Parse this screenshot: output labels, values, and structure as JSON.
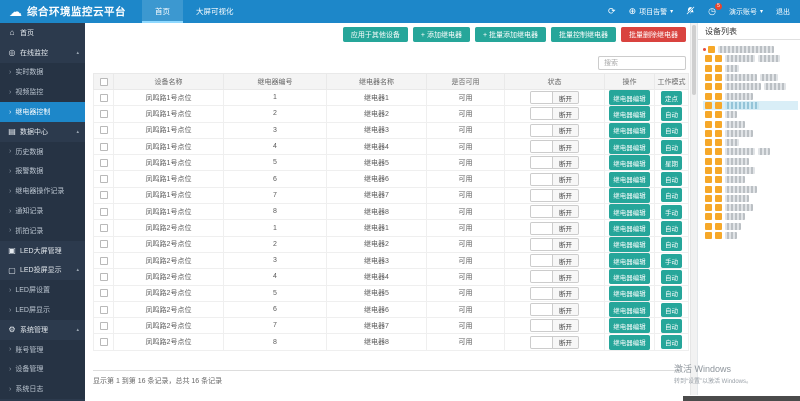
{
  "theme": {
    "navbar": "#1d87c9",
    "sidebar": "#2c3a4d",
    "active_blue": "#1d87c9",
    "teal": "#26a69a",
    "red": "#d9433f"
  },
  "navbar": {
    "title": "综合环境监控云平台",
    "tabs": [
      {
        "id": "home",
        "label": "首页",
        "active": true
      },
      {
        "id": "big-screen",
        "label": "大屏可视化",
        "active": false
      }
    ],
    "right": {
      "refresh": "⟳",
      "alarm_dropdown": "项目告警",
      "badge_count": "5",
      "account": "演示账号",
      "logout": "退出"
    }
  },
  "sidebar": {
    "items": [
      {
        "id": "home",
        "label": "首页",
        "type": "parent",
        "icon": "home"
      },
      {
        "id": "online-monitor",
        "label": "在线监控",
        "type": "parent",
        "icon": "monitor",
        "arrow": true
      },
      {
        "id": "realtime-data",
        "label": "实时数据",
        "type": "sub"
      },
      {
        "id": "video-monitor",
        "label": "视频监控",
        "type": "sub"
      },
      {
        "id": "relay-control",
        "label": "继电器控制",
        "type": "sub",
        "active": true
      },
      {
        "id": "data-center",
        "label": "数据中心",
        "type": "parent",
        "icon": "data",
        "arrow": true
      },
      {
        "id": "history-data",
        "label": "历史数据",
        "type": "sub"
      },
      {
        "id": "alarm-data",
        "label": "报警数据",
        "type": "sub"
      },
      {
        "id": "relay-op-log",
        "label": "继电器操作记录",
        "type": "sub"
      },
      {
        "id": "notify-log",
        "label": "通知记录",
        "type": "sub"
      },
      {
        "id": "snapshot-log",
        "label": "抓拍记录",
        "type": "sub"
      },
      {
        "id": "led-screen-mgmt",
        "label": "LED大屏管理",
        "type": "parent",
        "icon": "led"
      },
      {
        "id": "led-cast-display",
        "label": "LED投屏显示",
        "type": "parent",
        "icon": "screen",
        "arrow": true
      },
      {
        "id": "led-settings",
        "label": "LED屏设置",
        "type": "sub"
      },
      {
        "id": "led-display",
        "label": "LED屏显示",
        "type": "sub"
      },
      {
        "id": "system-mgmt",
        "label": "系统管理",
        "type": "parent",
        "icon": "gear",
        "arrow": true
      },
      {
        "id": "account-mgmt",
        "label": "账号管理",
        "type": "sub"
      },
      {
        "id": "device-mgmt",
        "label": "设备管理",
        "type": "sub"
      },
      {
        "id": "system-log",
        "label": "系统日志",
        "type": "sub"
      }
    ]
  },
  "toolbar": {
    "buttons": [
      {
        "id": "apply-to-other-devices",
        "label": "应用于其他设备",
        "style": "teal"
      },
      {
        "id": "add-relay",
        "label": "+ 添加继电器",
        "style": "teal"
      },
      {
        "id": "batch-add-relay",
        "label": "+ 批量添加继电器",
        "style": "teal"
      },
      {
        "id": "batch-control-relay",
        "label": "批量控制继电器",
        "style": "teal"
      },
      {
        "id": "batch-delete-relay",
        "label": "批量删除继电器",
        "style": "red"
      }
    ]
  },
  "search": {
    "placeholder": "搜索"
  },
  "table": {
    "columns": [
      "设备名称",
      "继电器编号",
      "继电器名称",
      "是否可用",
      "状态",
      "操作",
      "工作模式"
    ],
    "action_label": "继电器编辑",
    "rows": [
      {
        "device": "凤鸣路1号点位",
        "no": "1",
        "name": "继电器1",
        "available": "可用",
        "status": "断开",
        "mode": "定点"
      },
      {
        "device": "凤鸣路1号点位",
        "no": "2",
        "name": "继电器2",
        "available": "可用",
        "status": "断开",
        "mode": "自动"
      },
      {
        "device": "凤鸣路1号点位",
        "no": "3",
        "name": "继电器3",
        "available": "可用",
        "status": "断开",
        "mode": "自动"
      },
      {
        "device": "凤鸣路1号点位",
        "no": "4",
        "name": "继电器4",
        "available": "可用",
        "status": "断开",
        "mode": "自动"
      },
      {
        "device": "凤鸣路1号点位",
        "no": "5",
        "name": "继电器5",
        "available": "可用",
        "status": "断开",
        "mode": "星期"
      },
      {
        "device": "凤鸣路1号点位",
        "no": "6",
        "name": "继电器6",
        "available": "可用",
        "status": "断开",
        "mode": "自动"
      },
      {
        "device": "凤鸣路1号点位",
        "no": "7",
        "name": "继电器7",
        "available": "可用",
        "status": "断开",
        "mode": "自动"
      },
      {
        "device": "凤鸣路1号点位",
        "no": "8",
        "name": "继电器8",
        "available": "可用",
        "status": "断开",
        "mode": "手动"
      },
      {
        "device": "凤鸣路2号点位",
        "no": "1",
        "name": "继电器1",
        "available": "可用",
        "status": "断开",
        "mode": "自动"
      },
      {
        "device": "凤鸣路2号点位",
        "no": "2",
        "name": "继电器2",
        "available": "可用",
        "status": "断开",
        "mode": "自动"
      },
      {
        "device": "凤鸣路2号点位",
        "no": "3",
        "name": "继电器3",
        "available": "可用",
        "status": "断开",
        "mode": "手动"
      },
      {
        "device": "凤鸣路2号点位",
        "no": "4",
        "name": "继电器4",
        "available": "可用",
        "status": "断开",
        "mode": "自动"
      },
      {
        "device": "凤鸣路2号点位",
        "no": "5",
        "name": "继电器5",
        "available": "可用",
        "status": "断开",
        "mode": "自动"
      },
      {
        "device": "凤鸣路2号点位",
        "no": "6",
        "name": "继电器6",
        "available": "可用",
        "status": "断开",
        "mode": "自动"
      },
      {
        "device": "凤鸣路2号点位",
        "no": "7",
        "name": "继电器7",
        "available": "可用",
        "status": "断开",
        "mode": "自动"
      },
      {
        "device": "凤鸣路2号点位",
        "no": "8",
        "name": "继电器8",
        "available": "可用",
        "status": "断开",
        "mode": "自动"
      }
    ],
    "footer": "显示第 1 到第 16 条记录，总共 16 条记录"
  },
  "device_panel": {
    "title": "设备列表"
  },
  "watermark": {
    "line1": "激活 Windows",
    "line2": "转到“设置”以激活 Windows。"
  }
}
